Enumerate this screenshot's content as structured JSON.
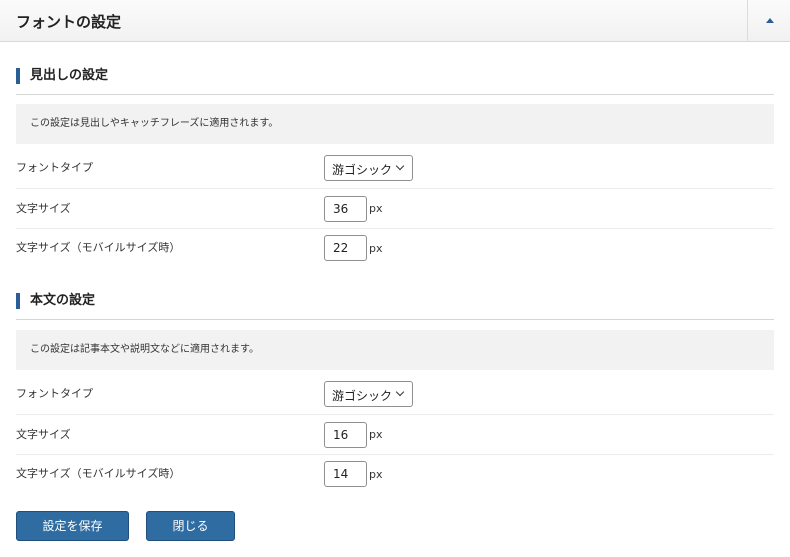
{
  "panel": {
    "title": "フォントの設定"
  },
  "headings": {
    "title": "見出しの設定",
    "note": "この設定は見出しやキャッチフレーズに適用されます。",
    "font_type_label": "フォントタイプ",
    "font_type_value": "游ゴシック",
    "font_size_label": "文字サイズ",
    "font_size_value": "36",
    "font_size_mobile_label": "文字サイズ（モバイルサイズ時）",
    "font_size_mobile_value": "22",
    "unit": "px"
  },
  "body_text": {
    "title": "本文の設定",
    "note": "この設定は記事本文や説明文などに適用されます。",
    "font_type_label": "フォントタイプ",
    "font_type_value": "游ゴシック",
    "font_size_label": "文字サイズ",
    "font_size_value": "16",
    "font_size_mobile_label": "文字サイズ（モバイルサイズ時）",
    "font_size_mobile_value": "14",
    "unit": "px"
  },
  "actions": {
    "save_label": "設定を保存",
    "close_label": "閉じる"
  },
  "colors": {
    "accent": "#2f6ca2",
    "header_bg": "#f4f4f4",
    "note_bg": "#f2f2f2"
  },
  "icons": {
    "toggle": "caret-up-icon",
    "select": "chevron-down-icon"
  }
}
